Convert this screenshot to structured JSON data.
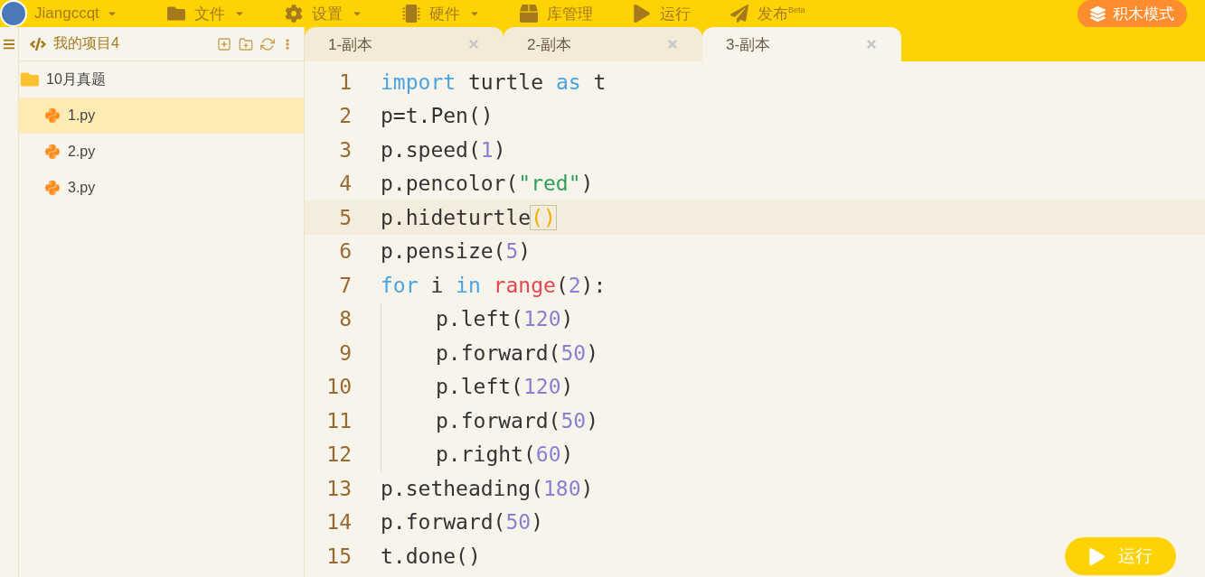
{
  "top_bar": {
    "user": "Jiangccqt",
    "menus": [
      {
        "label": "文件",
        "dropdown": true
      },
      {
        "label": "设置",
        "dropdown": true
      },
      {
        "label": "硬件",
        "dropdown": true
      },
      {
        "label": "库管理",
        "dropdown": false
      },
      {
        "label": "运行",
        "dropdown": false
      },
      {
        "label": "发布",
        "sup": "Beta",
        "dropdown": false
      }
    ],
    "mode_button": "积木模式"
  },
  "sidebar": {
    "project": "我的项目4",
    "tree": [
      {
        "label": "10月真题",
        "kind": "folder",
        "selected": false,
        "children": [
          {
            "label": "1.py",
            "kind": "file",
            "selected": true
          },
          {
            "label": "2.py",
            "kind": "file",
            "selected": false
          },
          {
            "label": "3.py",
            "kind": "file",
            "selected": false
          }
        ]
      }
    ]
  },
  "tabs": [
    {
      "label": "1-副本",
      "selected": false
    },
    {
      "label": "2-副本",
      "selected": false
    },
    {
      "label": "3-副本",
      "selected": true
    }
  ],
  "editor": {
    "lines": [
      {
        "number": "1",
        "current": false,
        "tokens": [
          {
            "t": "import",
            "kind": "keyword"
          },
          {
            "t": " turtle ",
            "kind": "plain"
          },
          {
            "t": "as",
            "kind": "keyword"
          },
          {
            "t": " t",
            "kind": "plain"
          }
        ]
      },
      {
        "number": "2",
        "current": false,
        "tokens": [
          {
            "t": "p=t.Pen()",
            "kind": "plain"
          }
        ]
      },
      {
        "number": "3",
        "current": false,
        "tokens": [
          {
            "t": "p.speed(",
            "kind": "plain"
          },
          {
            "t": "1",
            "kind": "number"
          },
          {
            "t": ")",
            "kind": "plain"
          }
        ]
      },
      {
        "number": "4",
        "current": false,
        "tokens": [
          {
            "t": "p.pencolor(",
            "kind": "plain"
          },
          {
            "t": "\"red\"",
            "kind": "string"
          },
          {
            "t": ")",
            "kind": "plain"
          }
        ]
      },
      {
        "number": "5",
        "current": true,
        "tokens": [
          {
            "t": "p.hideturtle",
            "kind": "plain"
          },
          {
            "t": "()",
            "kind": "match"
          }
        ]
      },
      {
        "number": "6",
        "current": false,
        "tokens": [
          {
            "t": "p.pensize(",
            "kind": "plain"
          },
          {
            "t": "5",
            "kind": "number"
          },
          {
            "t": ")",
            "kind": "plain"
          }
        ]
      },
      {
        "number": "7",
        "current": false,
        "tokens": [
          {
            "t": "for",
            "kind": "keyword"
          },
          {
            "t": " i ",
            "kind": "plain"
          },
          {
            "t": "in ",
            "kind": "keyword"
          },
          {
            "t": "range",
            "kind": "builtin"
          },
          {
            "t": "(",
            "kind": "plain"
          },
          {
            "t": "2",
            "kind": "number"
          },
          {
            "t": "):",
            "kind": "plain"
          }
        ],
        "children": [
          {
            "number": "8",
            "current": false,
            "tokens": [
              {
                "t": "p.left(",
                "kind": "plain"
              },
              {
                "t": "120",
                "kind": "number"
              },
              {
                "t": ")",
                "kind": "plain"
              }
            ]
          },
          {
            "number": "9",
            "current": false,
            "tokens": [
              {
                "t": "p.forward(",
                "kind": "plain"
              },
              {
                "t": "50",
                "kind": "number"
              },
              {
                "t": ")",
                "kind": "plain"
              }
            ]
          },
          {
            "number": "10",
            "current": false,
            "tokens": [
              {
                "t": "p.left(",
                "kind": "plain"
              },
              {
                "t": "120",
                "kind": "number"
              },
              {
                "t": ")",
                "kind": "plain"
              }
            ]
          },
          {
            "number": "11",
            "current": false,
            "tokens": [
              {
                "t": "p.forward(",
                "kind": "plain"
              },
              {
                "t": "50",
                "kind": "number"
              },
              {
                "t": ")",
                "kind": "plain"
              }
            ]
          },
          {
            "number": "12",
            "current": false,
            "tokens": [
              {
                "t": "p.right(",
                "kind": "plain"
              },
              {
                "t": "60",
                "kind": "number"
              },
              {
                "t": ")",
                "kind": "plain"
              }
            ]
          }
        ]
      },
      {
        "number": "13",
        "current": false,
        "tokens": [
          {
            "t": "p.setheading(",
            "kind": "plain"
          },
          {
            "t": "180",
            "kind": "number"
          },
          {
            "t": ")",
            "kind": "plain"
          }
        ]
      },
      {
        "number": "14",
        "current": false,
        "tokens": [
          {
            "t": "p.forward(",
            "kind": "plain"
          },
          {
            "t": "50",
            "kind": "number"
          },
          {
            "t": ")",
            "kind": "plain"
          }
        ]
      },
      {
        "number": "15",
        "current": false,
        "tokens": [
          {
            "t": "t.done()",
            "kind": "plain"
          }
        ]
      }
    ]
  },
  "run_button": "运行"
}
